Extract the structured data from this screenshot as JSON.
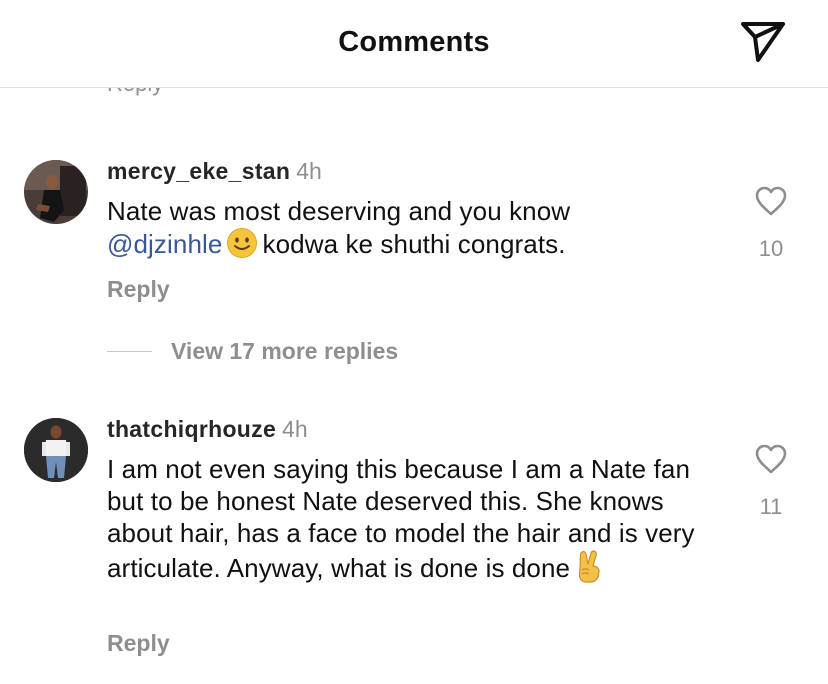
{
  "header": {
    "title": "Comments",
    "share_icon": "send-paper-plane-icon"
  },
  "previous_comment": {
    "reply_label": "Reply"
  },
  "comments": [
    {
      "username": "mercy_eke_stan",
      "time": "4h",
      "text_before_mention": "Nate was most deserving and you know",
      "mention": "@djzinhle",
      "emoji": "slightly-smiling-face",
      "text_after_emoji": "kodwa ke shuthi congrats.",
      "likes": "10",
      "reply_label": "Reply",
      "view_replies_label": "View 17 more replies"
    },
    {
      "username": "thatchiqrhouze",
      "time": "4h",
      "text": "I am not even saying this because I am a Nate fan but to be honest Nate deserved this. She knows about hair, has a face to model  the hair and is very articulate. Anyway, what is done is done",
      "emoji": "victory-hand",
      "likes": "11",
      "reply_label": "Reply"
    }
  ],
  "colors": {
    "mention": "#385898",
    "secondary_text": "#8e8e8e",
    "primary_text": "#111111"
  }
}
